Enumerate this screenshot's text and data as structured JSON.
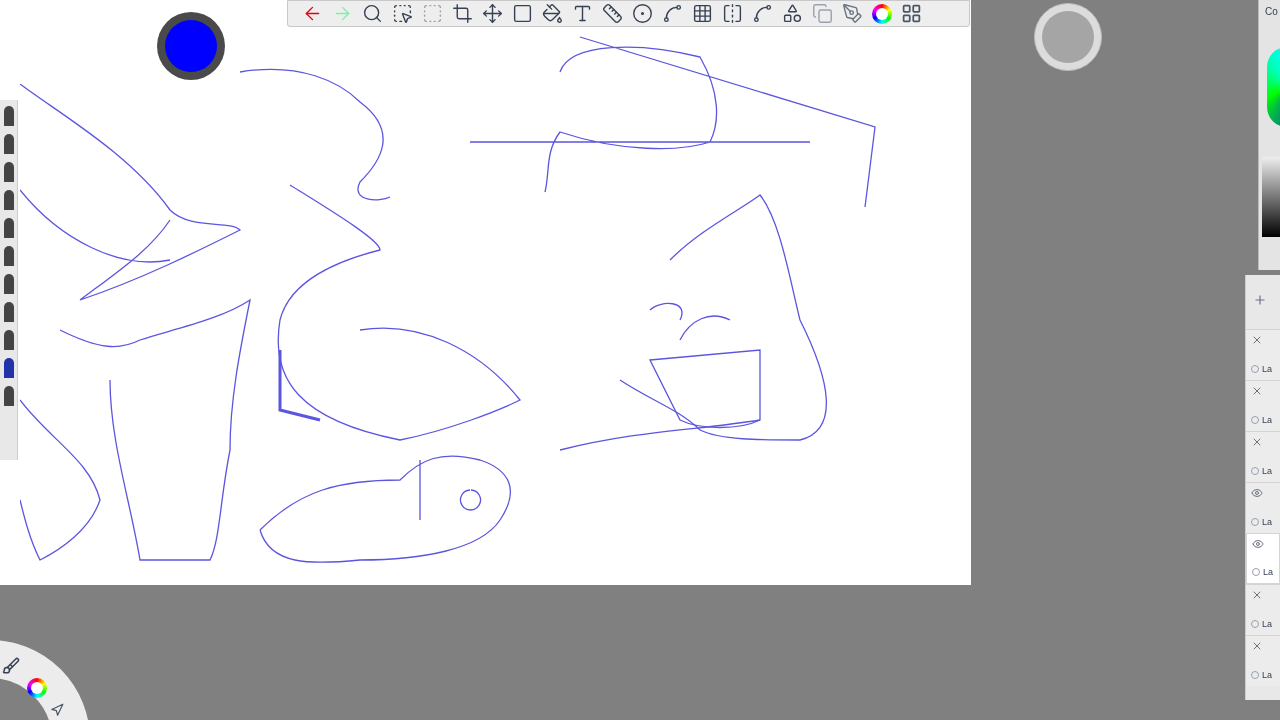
{
  "brush_puck": {
    "color": "#0000ff"
  },
  "color_panel": {
    "title": "Co"
  },
  "layers": [
    {
      "label": "La",
      "visible": false,
      "selected": false
    },
    {
      "label": "La",
      "visible": false,
      "selected": false
    },
    {
      "label": "La",
      "visible": false,
      "selected": false
    },
    {
      "label": "La",
      "visible": true,
      "selected": false
    },
    {
      "label": "La",
      "visible": true,
      "selected": true
    },
    {
      "label": "La",
      "visible": false,
      "selected": false
    },
    {
      "label": "La",
      "visible": false,
      "selected": false
    }
  ]
}
